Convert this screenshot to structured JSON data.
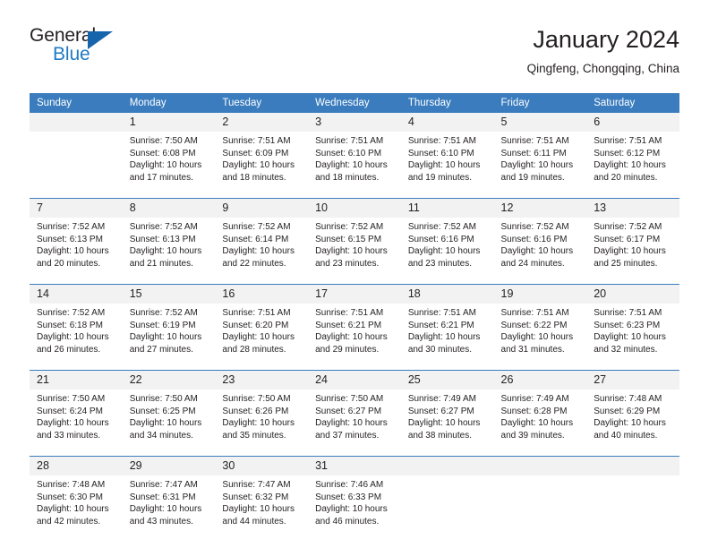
{
  "brand": {
    "name_part1": "General",
    "name_part2": "Blue",
    "accent_color": "#1664ab",
    "blue_text_color": "#1e7ac4"
  },
  "header": {
    "title": "January 2024",
    "subtitle": "Qingfeng, Chongqing, China"
  },
  "calendar": {
    "header_bg": "#3a7cbe",
    "daynum_bg": "#f2f2f2",
    "weekday_headers": [
      "Sunday",
      "Monday",
      "Tuesday",
      "Wednesday",
      "Thursday",
      "Friday",
      "Saturday"
    ],
    "weeks": [
      {
        "days": [
          {
            "number": "",
            "sunrise": "",
            "sunset": "",
            "daylight_line1": "",
            "daylight_line2": ""
          },
          {
            "number": "1",
            "sunrise": "Sunrise: 7:50 AM",
            "sunset": "Sunset: 6:08 PM",
            "daylight_line1": "Daylight: 10 hours",
            "daylight_line2": "and 17 minutes."
          },
          {
            "number": "2",
            "sunrise": "Sunrise: 7:51 AM",
            "sunset": "Sunset: 6:09 PM",
            "daylight_line1": "Daylight: 10 hours",
            "daylight_line2": "and 18 minutes."
          },
          {
            "number": "3",
            "sunrise": "Sunrise: 7:51 AM",
            "sunset": "Sunset: 6:10 PM",
            "daylight_line1": "Daylight: 10 hours",
            "daylight_line2": "and 18 minutes."
          },
          {
            "number": "4",
            "sunrise": "Sunrise: 7:51 AM",
            "sunset": "Sunset: 6:10 PM",
            "daylight_line1": "Daylight: 10 hours",
            "daylight_line2": "and 19 minutes."
          },
          {
            "number": "5",
            "sunrise": "Sunrise: 7:51 AM",
            "sunset": "Sunset: 6:11 PM",
            "daylight_line1": "Daylight: 10 hours",
            "daylight_line2": "and 19 minutes."
          },
          {
            "number": "6",
            "sunrise": "Sunrise: 7:51 AM",
            "sunset": "Sunset: 6:12 PM",
            "daylight_line1": "Daylight: 10 hours",
            "daylight_line2": "and 20 minutes."
          }
        ]
      },
      {
        "days": [
          {
            "number": "7",
            "sunrise": "Sunrise: 7:52 AM",
            "sunset": "Sunset: 6:13 PM",
            "daylight_line1": "Daylight: 10 hours",
            "daylight_line2": "and 20 minutes."
          },
          {
            "number": "8",
            "sunrise": "Sunrise: 7:52 AM",
            "sunset": "Sunset: 6:13 PM",
            "daylight_line1": "Daylight: 10 hours",
            "daylight_line2": "and 21 minutes."
          },
          {
            "number": "9",
            "sunrise": "Sunrise: 7:52 AM",
            "sunset": "Sunset: 6:14 PM",
            "daylight_line1": "Daylight: 10 hours",
            "daylight_line2": "and 22 minutes."
          },
          {
            "number": "10",
            "sunrise": "Sunrise: 7:52 AM",
            "sunset": "Sunset: 6:15 PM",
            "daylight_line1": "Daylight: 10 hours",
            "daylight_line2": "and 23 minutes."
          },
          {
            "number": "11",
            "sunrise": "Sunrise: 7:52 AM",
            "sunset": "Sunset: 6:16 PM",
            "daylight_line1": "Daylight: 10 hours",
            "daylight_line2": "and 23 minutes."
          },
          {
            "number": "12",
            "sunrise": "Sunrise: 7:52 AM",
            "sunset": "Sunset: 6:16 PM",
            "daylight_line1": "Daylight: 10 hours",
            "daylight_line2": "and 24 minutes."
          },
          {
            "number": "13",
            "sunrise": "Sunrise: 7:52 AM",
            "sunset": "Sunset: 6:17 PM",
            "daylight_line1": "Daylight: 10 hours",
            "daylight_line2": "and 25 minutes."
          }
        ]
      },
      {
        "days": [
          {
            "number": "14",
            "sunrise": "Sunrise: 7:52 AM",
            "sunset": "Sunset: 6:18 PM",
            "daylight_line1": "Daylight: 10 hours",
            "daylight_line2": "and 26 minutes."
          },
          {
            "number": "15",
            "sunrise": "Sunrise: 7:52 AM",
            "sunset": "Sunset: 6:19 PM",
            "daylight_line1": "Daylight: 10 hours",
            "daylight_line2": "and 27 minutes."
          },
          {
            "number": "16",
            "sunrise": "Sunrise: 7:51 AM",
            "sunset": "Sunset: 6:20 PM",
            "daylight_line1": "Daylight: 10 hours",
            "daylight_line2": "and 28 minutes."
          },
          {
            "number": "17",
            "sunrise": "Sunrise: 7:51 AM",
            "sunset": "Sunset: 6:21 PM",
            "daylight_line1": "Daylight: 10 hours",
            "daylight_line2": "and 29 minutes."
          },
          {
            "number": "18",
            "sunrise": "Sunrise: 7:51 AM",
            "sunset": "Sunset: 6:21 PM",
            "daylight_line1": "Daylight: 10 hours",
            "daylight_line2": "and 30 minutes."
          },
          {
            "number": "19",
            "sunrise": "Sunrise: 7:51 AM",
            "sunset": "Sunset: 6:22 PM",
            "daylight_line1": "Daylight: 10 hours",
            "daylight_line2": "and 31 minutes."
          },
          {
            "number": "20",
            "sunrise": "Sunrise: 7:51 AM",
            "sunset": "Sunset: 6:23 PM",
            "daylight_line1": "Daylight: 10 hours",
            "daylight_line2": "and 32 minutes."
          }
        ]
      },
      {
        "days": [
          {
            "number": "21",
            "sunrise": "Sunrise: 7:50 AM",
            "sunset": "Sunset: 6:24 PM",
            "daylight_line1": "Daylight: 10 hours",
            "daylight_line2": "and 33 minutes."
          },
          {
            "number": "22",
            "sunrise": "Sunrise: 7:50 AM",
            "sunset": "Sunset: 6:25 PM",
            "daylight_line1": "Daylight: 10 hours",
            "daylight_line2": "and 34 minutes."
          },
          {
            "number": "23",
            "sunrise": "Sunrise: 7:50 AM",
            "sunset": "Sunset: 6:26 PM",
            "daylight_line1": "Daylight: 10 hours",
            "daylight_line2": "and 35 minutes."
          },
          {
            "number": "24",
            "sunrise": "Sunrise: 7:50 AM",
            "sunset": "Sunset: 6:27 PM",
            "daylight_line1": "Daylight: 10 hours",
            "daylight_line2": "and 37 minutes."
          },
          {
            "number": "25",
            "sunrise": "Sunrise: 7:49 AM",
            "sunset": "Sunset: 6:27 PM",
            "daylight_line1": "Daylight: 10 hours",
            "daylight_line2": "and 38 minutes."
          },
          {
            "number": "26",
            "sunrise": "Sunrise: 7:49 AM",
            "sunset": "Sunset: 6:28 PM",
            "daylight_line1": "Daylight: 10 hours",
            "daylight_line2": "and 39 minutes."
          },
          {
            "number": "27",
            "sunrise": "Sunrise: 7:48 AM",
            "sunset": "Sunset: 6:29 PM",
            "daylight_line1": "Daylight: 10 hours",
            "daylight_line2": "and 40 minutes."
          }
        ]
      },
      {
        "days": [
          {
            "number": "28",
            "sunrise": "Sunrise: 7:48 AM",
            "sunset": "Sunset: 6:30 PM",
            "daylight_line1": "Daylight: 10 hours",
            "daylight_line2": "and 42 minutes."
          },
          {
            "number": "29",
            "sunrise": "Sunrise: 7:47 AM",
            "sunset": "Sunset: 6:31 PM",
            "daylight_line1": "Daylight: 10 hours",
            "daylight_line2": "and 43 minutes."
          },
          {
            "number": "30",
            "sunrise": "Sunrise: 7:47 AM",
            "sunset": "Sunset: 6:32 PM",
            "daylight_line1": "Daylight: 10 hours",
            "daylight_line2": "and 44 minutes."
          },
          {
            "number": "31",
            "sunrise": "Sunrise: 7:46 AM",
            "sunset": "Sunset: 6:33 PM",
            "daylight_line1": "Daylight: 10 hours",
            "daylight_line2": "and 46 minutes."
          },
          {
            "number": "",
            "sunrise": "",
            "sunset": "",
            "daylight_line1": "",
            "daylight_line2": ""
          },
          {
            "number": "",
            "sunrise": "",
            "sunset": "",
            "daylight_line1": "",
            "daylight_line2": ""
          },
          {
            "number": "",
            "sunrise": "",
            "sunset": "",
            "daylight_line1": "",
            "daylight_line2": ""
          }
        ]
      }
    ]
  }
}
